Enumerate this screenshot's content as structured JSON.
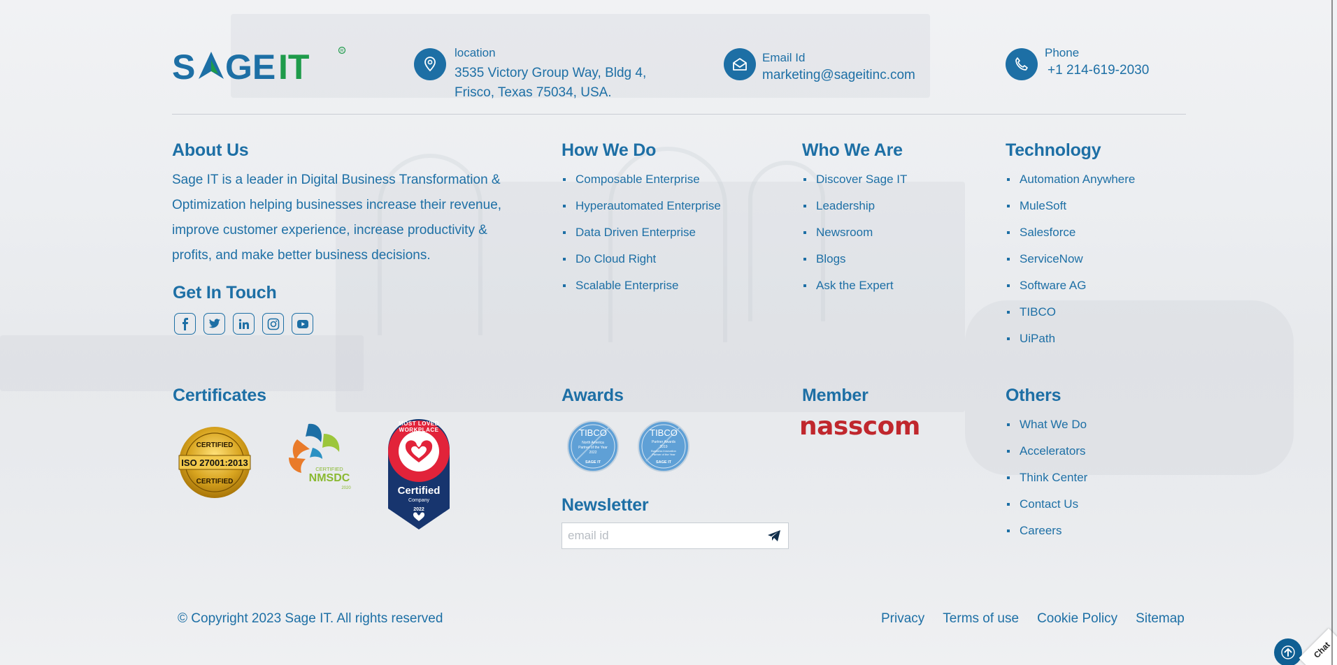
{
  "brand": {
    "name": "SAGE IT",
    "registered": "®",
    "accent_blue": "#1d6fa5",
    "accent_green": "#1e9b4a"
  },
  "contact": {
    "location": {
      "label": "location",
      "line1": "3535 Victory Group Way, Bldg 4,",
      "line2": "Frisco, Texas 75034, USA.",
      "icon": "location-pin-icon"
    },
    "email": {
      "label": "Email Id",
      "value": "marketing@sageitinc.com",
      "icon": "envelope-icon"
    },
    "phone": {
      "label": "Phone",
      "value": "+1 214-619-2030",
      "icon": "phone-icon"
    }
  },
  "about": {
    "title": "About Us",
    "text": "Sage IT is a leader in Digital Business Transformation & Optimization helping businesses increase their revenue, improve customer experience, increase productivity & profits, and make better business decisions."
  },
  "get_in_touch": {
    "title": "Get In Touch",
    "social": [
      "facebook-icon",
      "twitter-icon",
      "linkedin-icon",
      "instagram-icon",
      "youtube-icon"
    ]
  },
  "how_we_do": {
    "title": "How We Do",
    "items": [
      "Composable Enterprise",
      "Hyperautomated Enterprise",
      "Data Driven Enterprise",
      "Do Cloud Right",
      "Scalable Enterprise"
    ]
  },
  "who_we_are": {
    "title": "Who We Are",
    "items": [
      "Discover Sage IT",
      "Leadership",
      "Newsroom",
      "Blogs",
      "Ask the Expert"
    ]
  },
  "technology": {
    "title": "Technology",
    "items": [
      "Automation Anywhere",
      "MuleSoft",
      "Salesforce",
      "ServiceNow",
      "Software AG",
      "TIBCO",
      "UiPath"
    ]
  },
  "certificates": {
    "title": "Certificates",
    "iso": {
      "top": "CERTIFIED",
      "main": "ISO 27001:2013",
      "bottom": "CERTIFIED"
    },
    "nmsdc": {
      "line1": "CERTIFIED",
      "line2": "NMSDC",
      "line3": "2020"
    },
    "workplace": {
      "arc": "MOST LOVED WORKPLACE",
      "main": "Certified",
      "sub": "Company",
      "year": "2022"
    }
  },
  "awards": {
    "title": "Awards",
    "badges": [
      {
        "brand": "TIBCO",
        "text": "North America Partner of the Year 2022",
        "footer": "SAGE IT"
      },
      {
        "brand": "TIBCO",
        "text": "Partner Awards 2019 Business Innovation Partner of the Year",
        "footer": "SAGE IT"
      }
    ]
  },
  "member": {
    "title": "Member",
    "logo_text": "nasscom"
  },
  "newsletter": {
    "title": "Newsletter",
    "placeholder": "email id"
  },
  "others": {
    "title": "Others",
    "items": [
      "What We Do",
      "Accelerators",
      "Think Center",
      "Contact Us",
      "Careers"
    ]
  },
  "footer": {
    "copyright": "© Copyright 2023 Sage IT. All rights reserved",
    "links": [
      "Privacy",
      "Terms of use",
      "Cookie Policy",
      "Sitemap"
    ]
  },
  "widgets": {
    "chat_label": "Chat",
    "scroll_top_icon": "arrow-up-icon"
  }
}
